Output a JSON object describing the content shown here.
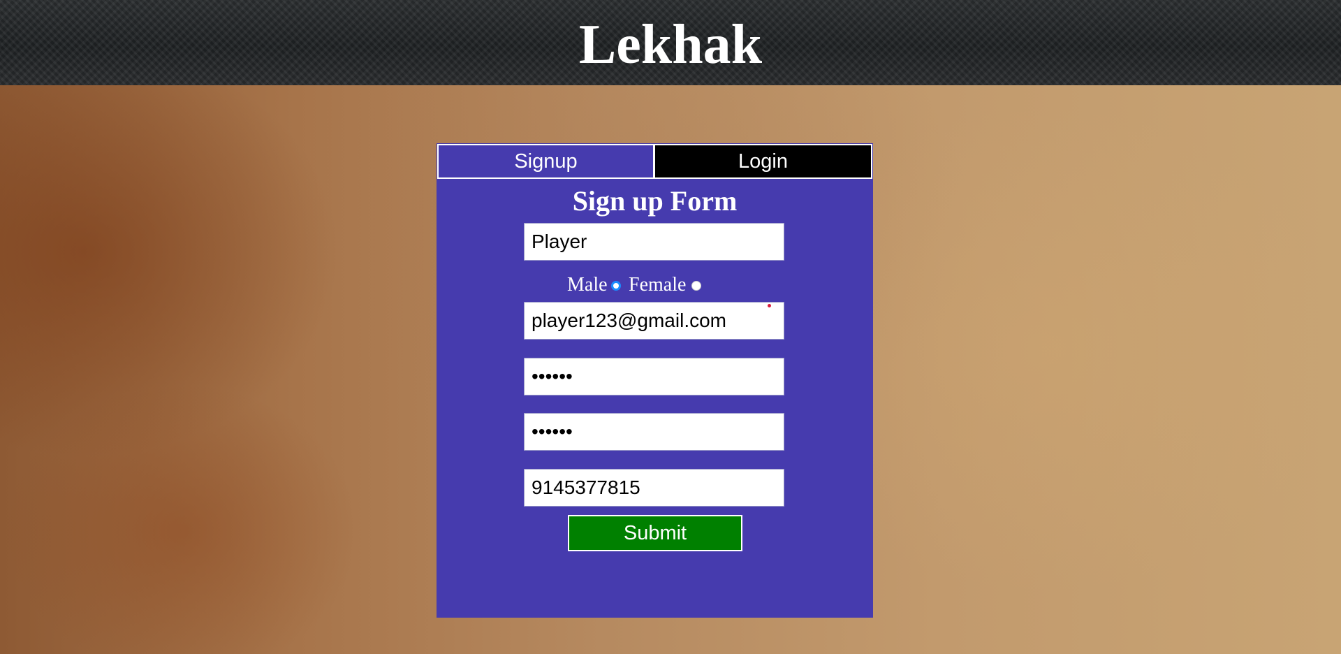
{
  "header": {
    "title": "Lekhak"
  },
  "tabs": [
    {
      "label": "Signup",
      "active": true
    },
    {
      "label": "Login",
      "active": false
    }
  ],
  "form": {
    "title": "Sign up Form",
    "name_value": "Player",
    "gender": {
      "options": [
        "Male",
        "Female"
      ],
      "selected": "Male"
    },
    "email_value": "player123@gmail.com",
    "password_masked": "••••••",
    "confirm_password_masked": "••••••",
    "phone_value": "9145377815",
    "submit_label": "Submit"
  },
  "colors": {
    "panel_bg": "#463bae",
    "login_tab_bg": "#000000",
    "submit_bg": "#008000",
    "radio_selected": "#1a8cff",
    "header_text": "#ffffff"
  }
}
